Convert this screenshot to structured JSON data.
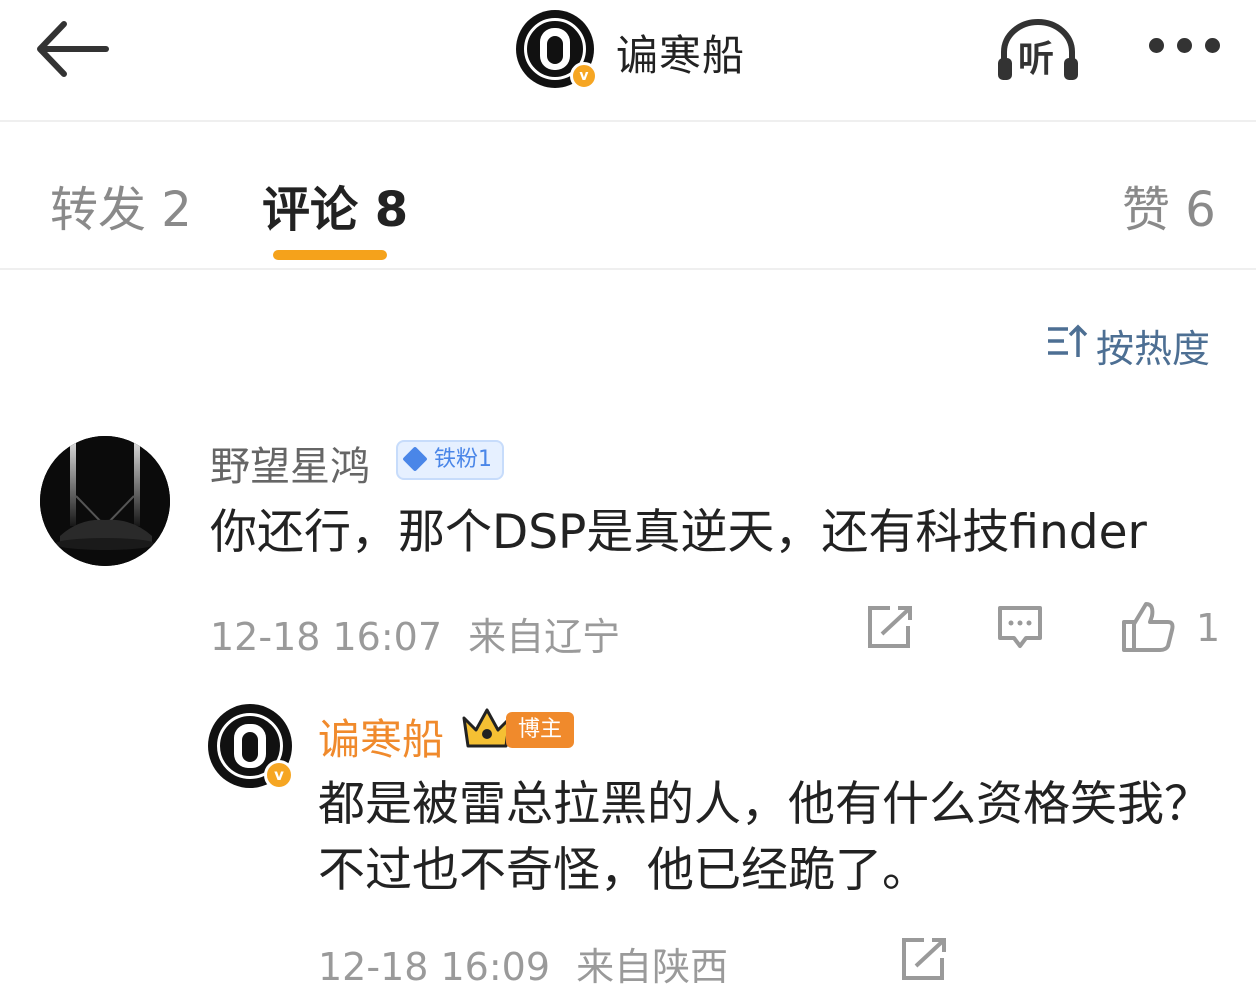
{
  "header": {
    "title": "谝寒船",
    "listen_label": "听",
    "back_icon": "arrow-left-icon",
    "more_icon": "more-dots-icon"
  },
  "tabs": [
    {
      "label": "转发 2"
    },
    {
      "label": "评论 8"
    },
    {
      "label": "赞 6"
    }
  ],
  "accent_color": "#f5a21b",
  "sort_label": "按热度",
  "comments": [
    {
      "user": "野望星鸿",
      "badge": "铁粉1",
      "text": "你还行，那个DSP是真逆天，还有科技finder",
      "time": "12-18 16:07",
      "location": "来自辽宁",
      "likes": "1",
      "reply": {
        "user": "谝寒船",
        "badge": "博主",
        "text": "都是被雷总拉黑的人，他有什么资格笑我？不过也不奇怪，他已经跪了。",
        "time": "12-18 16:09",
        "location": "来自陕西"
      }
    }
  ]
}
